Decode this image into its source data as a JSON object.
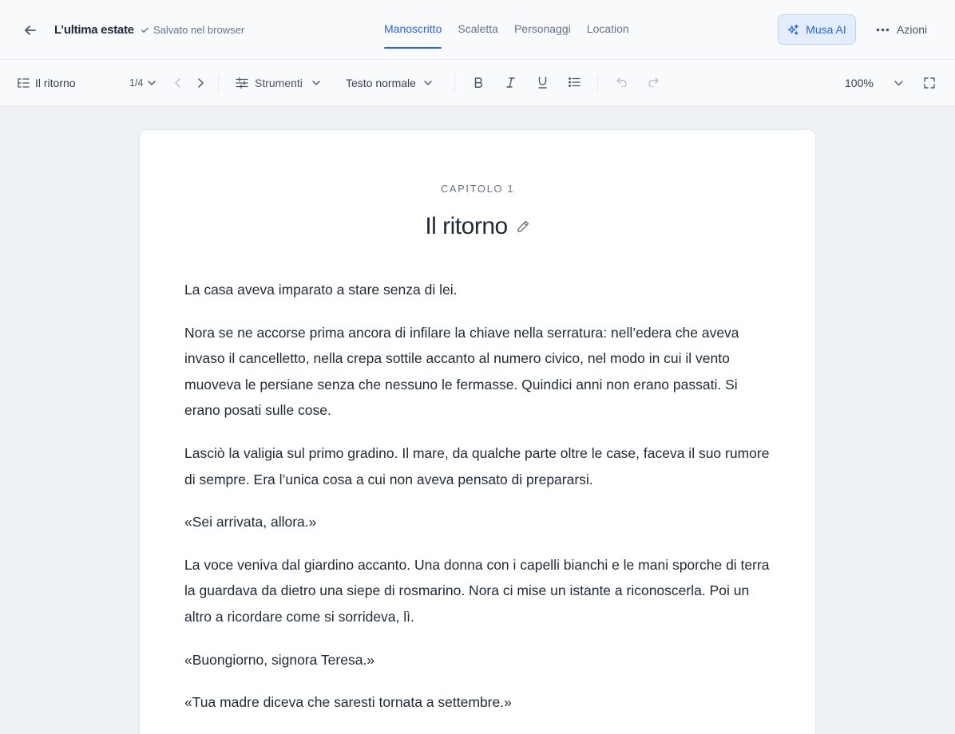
{
  "header": {
    "title": "L’ultima estate",
    "save_status": "Salvato nel browser",
    "tabs": [
      {
        "label": "Manoscritto",
        "active": true
      },
      {
        "label": "Scaletta",
        "active": false
      },
      {
        "label": "Personaggi",
        "active": false
      },
      {
        "label": "Location",
        "active": false
      }
    ],
    "ai_button": "Musa AI",
    "actions_label": "Azioni"
  },
  "toolbar": {
    "chapter_select": "Il ritorno",
    "chapter_counter": "1/4",
    "tools_label": "Strumenti",
    "text_style": "Testo normale",
    "zoom": "100%"
  },
  "chapter": {
    "label": "CAPITOLO 1",
    "title": "Il ritorno",
    "paragraphs": [
      "La casa aveva imparato a stare senza di lei.",
      "Nora se ne accorse prima ancora di infilare la chiave nella serratura: nell’edera che aveva invaso il cancelletto, nella crepa sottile accanto al numero civico, nel modo in cui il vento muoveva le persiane senza che nessuno le fermasse. Quindici anni non erano passati. Si erano posati sulle cose.",
      "Lasciò la valigia sul primo gradino. Il mare, da qualche parte oltre le case, faceva il suo rumore di sempre. Era l’unica cosa a cui non aveva pensato di prepararsi.",
      "«Sei arrivata, allora.»",
      "La voce veniva dal giardino accanto. Una donna con i capelli bianchi e le mani sporche di terra la guardava da dietro una siepe di rosmarino. Nora ci mise un istante a riconoscerla. Poi un altro a ricordare come si sorrideva, lì.",
      "«Buongiorno, signora Teresa.»",
      "«Tua madre diceva che saresti tornata a settembre.»"
    ]
  },
  "colors": {
    "accent": "#2563eb",
    "text": "#1f2937",
    "muted": "#64748b",
    "background": "#eef2f7"
  }
}
